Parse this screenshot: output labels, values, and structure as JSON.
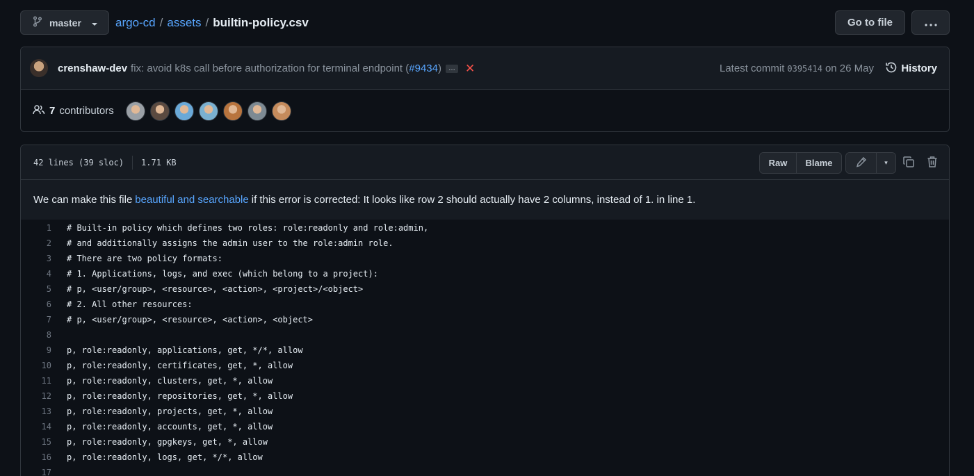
{
  "topbar": {
    "branch": "master",
    "breadcrumb": {
      "repo": "argo-cd",
      "folder": "assets",
      "file": "builtin-policy.csv",
      "sep": "/"
    },
    "goto_file": "Go to file",
    "more": "···"
  },
  "commit": {
    "author": "crenshaw-dev",
    "message_prefix": "fix: avoid k8s call before authorization for terminal endpoint (",
    "pr": "#9434",
    "message_suffix": ")",
    "ellipsis": "…",
    "status": "✕",
    "latest_label": "Latest commit",
    "sha": "0395414",
    "date": "on 26 May",
    "history": "History"
  },
  "contributors": {
    "count": "7",
    "label": "contributors",
    "avatar_colors": [
      "#9aa0a6",
      "#5b4a40",
      "#6aa9d8",
      "#7ab0d0",
      "#b8743e",
      "#7d8a93",
      "#c58b5c"
    ]
  },
  "file": {
    "lines_info": "42 lines (39 sloc)",
    "size": "1.71 KB",
    "raw": "Raw",
    "blame": "Blame",
    "edit_caret": "▾"
  },
  "warning": {
    "prefix": "We can make this file",
    "link": "beautiful and searchable",
    "suffix": "if this error is corrected: It looks like row 2 should actually have 2 columns, instead of 1. in line 1."
  },
  "code_lines": [
    {
      "n": "1",
      "text": "# Built-in policy which defines two roles: role:readonly and role:admin,"
    },
    {
      "n": "2",
      "text": "# and additionally assigns the admin user to the role:admin role."
    },
    {
      "n": "3",
      "text": "# There are two policy formats:"
    },
    {
      "n": "4",
      "text": "# 1. Applications, logs, and exec (which belong to a project):"
    },
    {
      "n": "5",
      "text": "# p, <user/group>, <resource>, <action>, <project>/<object>"
    },
    {
      "n": "6",
      "text": "# 2. All other resources:"
    },
    {
      "n": "7",
      "text": "# p, <user/group>, <resource>, <action>, <object>"
    },
    {
      "n": "8",
      "text": ""
    },
    {
      "n": "9",
      "text": "p, role:readonly, applications, get, */*, allow"
    },
    {
      "n": "10",
      "text": "p, role:readonly, certificates, get, *, allow"
    },
    {
      "n": "11",
      "text": "p, role:readonly, clusters, get, *, allow"
    },
    {
      "n": "12",
      "text": "p, role:readonly, repositories, get, *, allow"
    },
    {
      "n": "13",
      "text": "p, role:readonly, projects, get, *, allow"
    },
    {
      "n": "14",
      "text": "p, role:readonly, accounts, get, *, allow"
    },
    {
      "n": "15",
      "text": "p, role:readonly, gpgkeys, get, *, allow"
    },
    {
      "n": "16",
      "text": "p, role:readonly, logs, get, */*, allow"
    },
    {
      "n": "17",
      "text": ""
    }
  ]
}
